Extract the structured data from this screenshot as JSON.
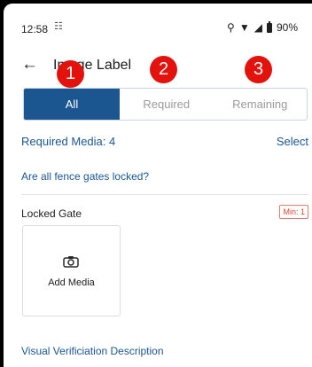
{
  "status_bar": {
    "time": "12:58",
    "battery": "90%"
  },
  "header": {
    "back_icon": "arrow-left-icon",
    "title": "Image Label"
  },
  "annotations": [
    "1",
    "2",
    "3"
  ],
  "tabs": [
    {
      "label": "All",
      "active": true
    },
    {
      "label": "Required",
      "active": false
    },
    {
      "label": "Remaining",
      "active": false
    }
  ],
  "media": {
    "required_label": "Required Media: 4",
    "select_label": "Select"
  },
  "question": "Are all fence gates locked?",
  "item": {
    "title": "Locked Gate",
    "min_badge": "Min: 1",
    "add_media_label": "Add Media"
  },
  "description_label": "Visual Verificiation Description",
  "colors": {
    "primary": "#1b5691",
    "badge_red": "#e3120d",
    "min_red": "#d8452f"
  }
}
